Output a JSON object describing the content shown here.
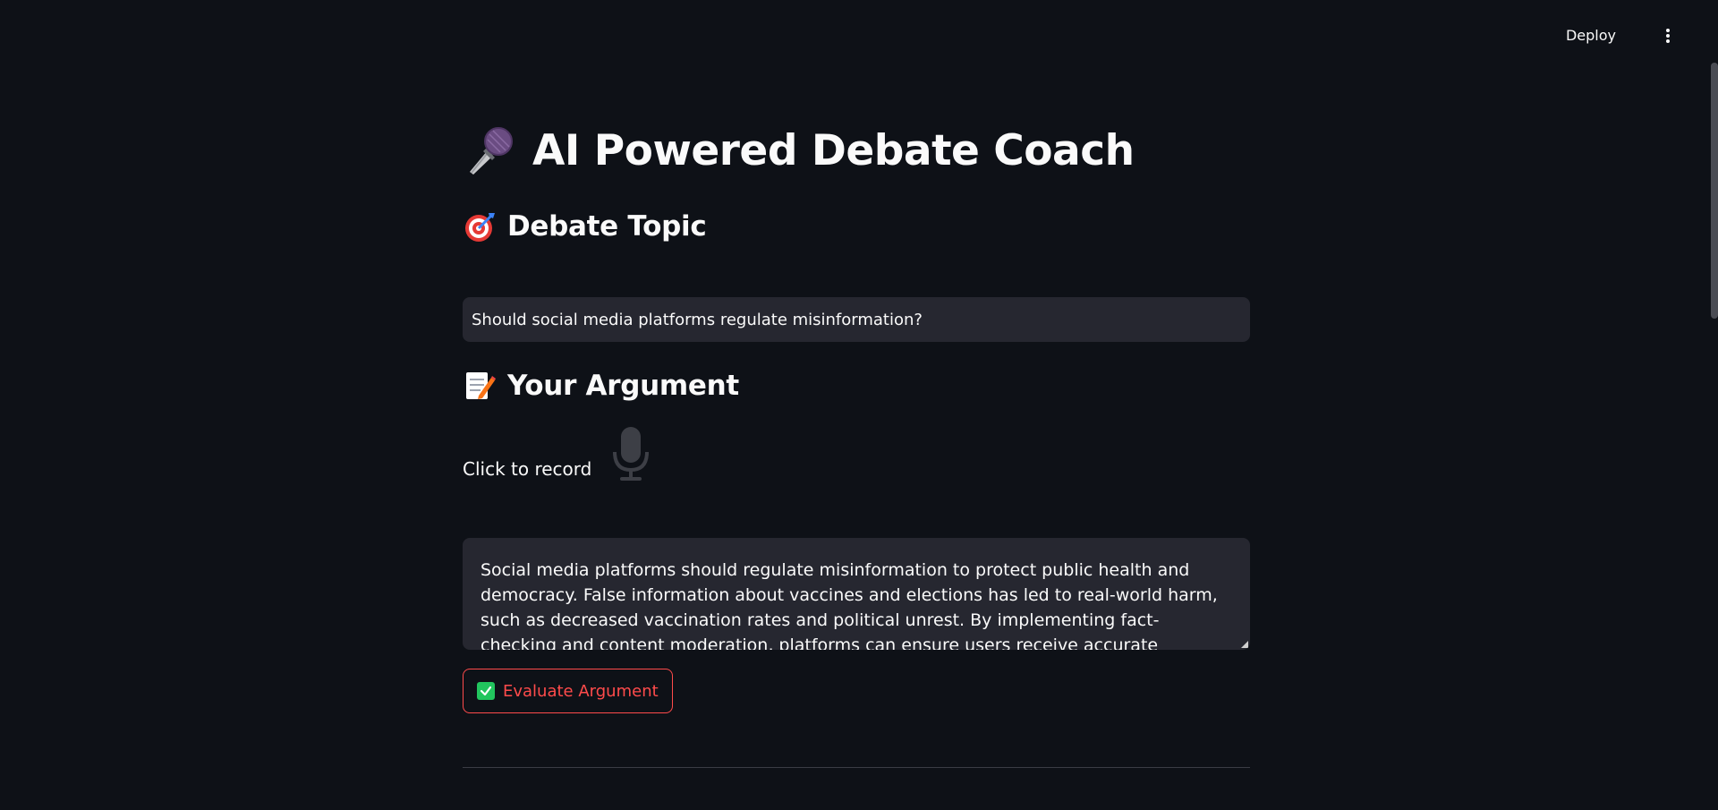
{
  "header": {
    "deploy_label": "Deploy",
    "menu_icon": "kebab-menu-icon"
  },
  "main": {
    "title": "AI Powered Debate Coach",
    "title_icon": "microphone-icon",
    "topic_heading": "Debate Topic",
    "topic_heading_icon": "target-icon",
    "topic_text": "Should social media platforms regulate misinformation?",
    "argument_heading": "Your Argument",
    "argument_heading_icon": "memo-icon",
    "record_label": "Click to record",
    "record_icon": "microphone-icon",
    "argument_text": "Social media platforms should regulate misinformation to protect public health and democracy. False information about vaccines and elections has led to real-world harm, such as decreased vaccination rates and political unrest. By implementing fact-checking and content moderation, platforms can ensure users receive accurate information while still allowing free speech within",
    "evaluate_label": "Evaluate Argument",
    "evaluate_icon": "check-mark-icon"
  },
  "colors": {
    "background": "#0e1117",
    "surface": "#262730",
    "text": "#fafafa",
    "accent": "#ff4b4b",
    "check_green": "#22c55e"
  }
}
